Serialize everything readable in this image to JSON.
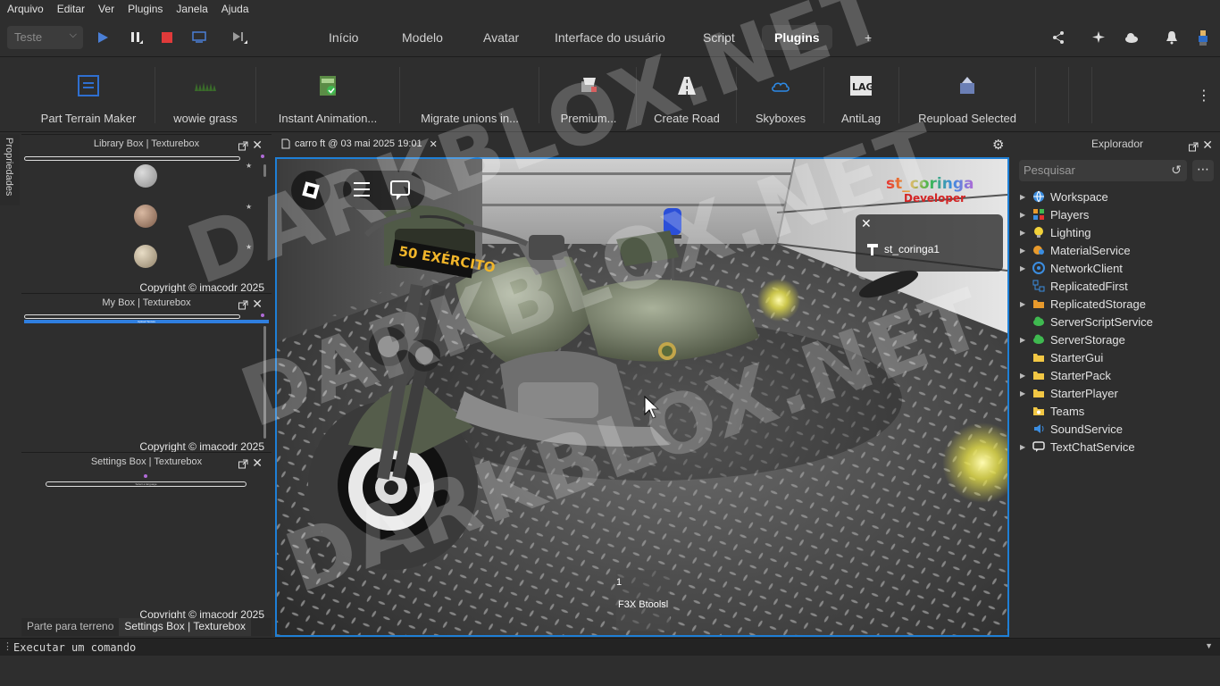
{
  "menu": [
    "Arquivo",
    "Editar",
    "Ver",
    "Plugins",
    "Janela",
    "Ajuda"
  ],
  "toolbar": {
    "mode_select": "Teste",
    "tabs": [
      "Início",
      "Modelo",
      "Avatar",
      "Interface do usuário",
      "Script",
      "Plugins",
      "+"
    ],
    "active_tab": "Plugins"
  },
  "ribbon": [
    "Part Terrain Maker",
    "wowie grass",
    "Instant Animation...",
    "Migrate unions in...",
    "Premium...",
    "Create Road",
    "Skyboxes",
    "AntiLag",
    "Reupload Selected"
  ],
  "sidebar_vertical_tab": "Propriedades",
  "panels": {
    "library": {
      "title": "Library Box | Texturebox",
      "copyright": "Copyright © imacodr 2025"
    },
    "mybox": {
      "title": "My Box | Texturebox",
      "upload_label": "Upload Texture",
      "copyright": "Copyright © imacodr 2025"
    },
    "settings": {
      "title": "Settings Box | Texturebox",
      "select_label": "Select a language",
      "copyright": "Copyright © imacodr 2025"
    }
  },
  "bottom_tabs": [
    "Parte para terreno",
    "Settings Box | Texturebox"
  ],
  "document_tab": "carro ft @ 03 mai 2025 19:01",
  "viewport": {
    "sign_text": "50 EXÉRCITO",
    "logo_line1": "st_coringa",
    "logo_line2": "Developer",
    "player_name": "st_coringa1",
    "hotbar_slot_number": "1",
    "hotbar_slot_label": "F3X Btoolsl"
  },
  "explorer": {
    "title": "Explorador",
    "search_placeholder": "Pesquisar",
    "items": [
      {
        "label": "Workspace",
        "expandable": true,
        "icon": "globe-icon",
        "color": "#3b8de0"
      },
      {
        "label": "Players",
        "expandable": true,
        "icon": "players-icon",
        "color": "#e89a2c"
      },
      {
        "label": "Lighting",
        "expandable": true,
        "icon": "bulb-icon",
        "color": "#f2d23a"
      },
      {
        "label": "MaterialService",
        "expandable": true,
        "icon": "material-icon",
        "color": "#e89a2c"
      },
      {
        "label": "NetworkClient",
        "expandable": true,
        "icon": "network-icon",
        "color": "#3b8de0"
      },
      {
        "label": "ReplicatedFirst",
        "expandable": false,
        "icon": "replicated-first-icon",
        "color": "#3b8de0"
      },
      {
        "label": "ReplicatedStorage",
        "expandable": true,
        "icon": "folder-icon",
        "color": "#e89a2c"
      },
      {
        "label": "ServerScriptService",
        "expandable": false,
        "icon": "server-icon",
        "color": "#3fb950"
      },
      {
        "label": "ServerStorage",
        "expandable": true,
        "icon": "server-icon",
        "color": "#3fb950"
      },
      {
        "label": "StarterGui",
        "expandable": false,
        "icon": "folder-icon",
        "color": "#f2c744"
      },
      {
        "label": "StarterPack",
        "expandable": true,
        "icon": "folder-icon",
        "color": "#f2c744"
      },
      {
        "label": "StarterPlayer",
        "expandable": true,
        "icon": "folder-icon",
        "color": "#f2c744"
      },
      {
        "label": "Teams",
        "expandable": false,
        "icon": "teams-icon",
        "color": "#f2c744"
      },
      {
        "label": "SoundService",
        "expandable": false,
        "icon": "sound-icon",
        "color": "#3b8de0"
      },
      {
        "label": "TextChatService",
        "expandable": true,
        "icon": "chat-icon",
        "color": "#e6e6e6"
      }
    ]
  },
  "command_placeholder": "Executar um comando",
  "watermark": "DARKBLOX.NET",
  "colors": {
    "accent": "#1e7fd6",
    "stop": "#e03a3a",
    "play": "#4a7fd6"
  }
}
